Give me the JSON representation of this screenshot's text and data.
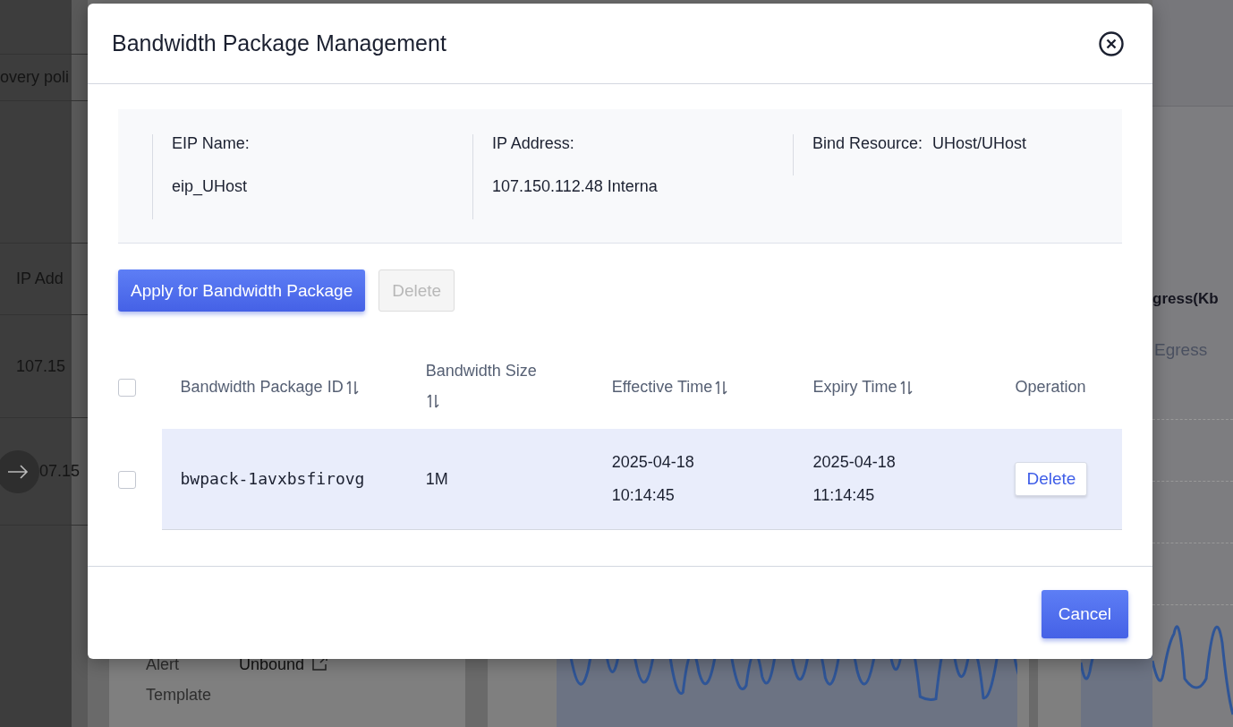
{
  "background": {
    "left_texts": [
      {
        "kind": "tab",
        "text": "overy poli"
      },
      {
        "kind": "header",
        "text": "IP Add"
      },
      {
        "kind": "cell",
        "text": "107.15"
      },
      {
        "kind": "arrow-cell",
        "text": "07.15"
      }
    ],
    "detail": {
      "alert_label": "Alert",
      "template_label": "Template",
      "alert_value": "Unbound"
    },
    "side_chart": {
      "title": "gress(Kb",
      "legend": "Egress"
    }
  },
  "modal": {
    "title": "Bandwidth Package Management",
    "info": [
      {
        "label": "EIP Name:",
        "value": "eip_UHost",
        "kind": "stacked"
      },
      {
        "label": "IP Address:",
        "value": "107.150.112.48 Interna",
        "kind": "stacked"
      },
      {
        "label": "Bind Resource:",
        "value": "UHost/UHost",
        "kind": "inline"
      }
    ],
    "actions": [
      {
        "label": "Apply for Bandwidth Package",
        "kind": "primary",
        "disabled": false
      },
      {
        "label": "Delete",
        "kind": "default",
        "disabled": true
      }
    ],
    "table": {
      "select_all_checked": false,
      "columns": [
        {
          "label": "Bandwidth Package ID",
          "sortable": true
        },
        {
          "label": "Bandwidth Size",
          "sortable": true
        },
        {
          "label": "Effective Time",
          "sortable": true
        },
        {
          "label": "Expiry Time",
          "sortable": true
        },
        {
          "label": "Operation",
          "sortable": false
        }
      ],
      "rows": [
        {
          "checked": false,
          "selected": true,
          "cells": [
            "bwpack-1avxbsfirovg",
            "1M",
            "2025-04-18 10:14:45",
            "2025-04-18 11:14:45"
          ],
          "action": "Delete"
        }
      ]
    },
    "footer": {
      "cancel": "Cancel"
    }
  }
}
